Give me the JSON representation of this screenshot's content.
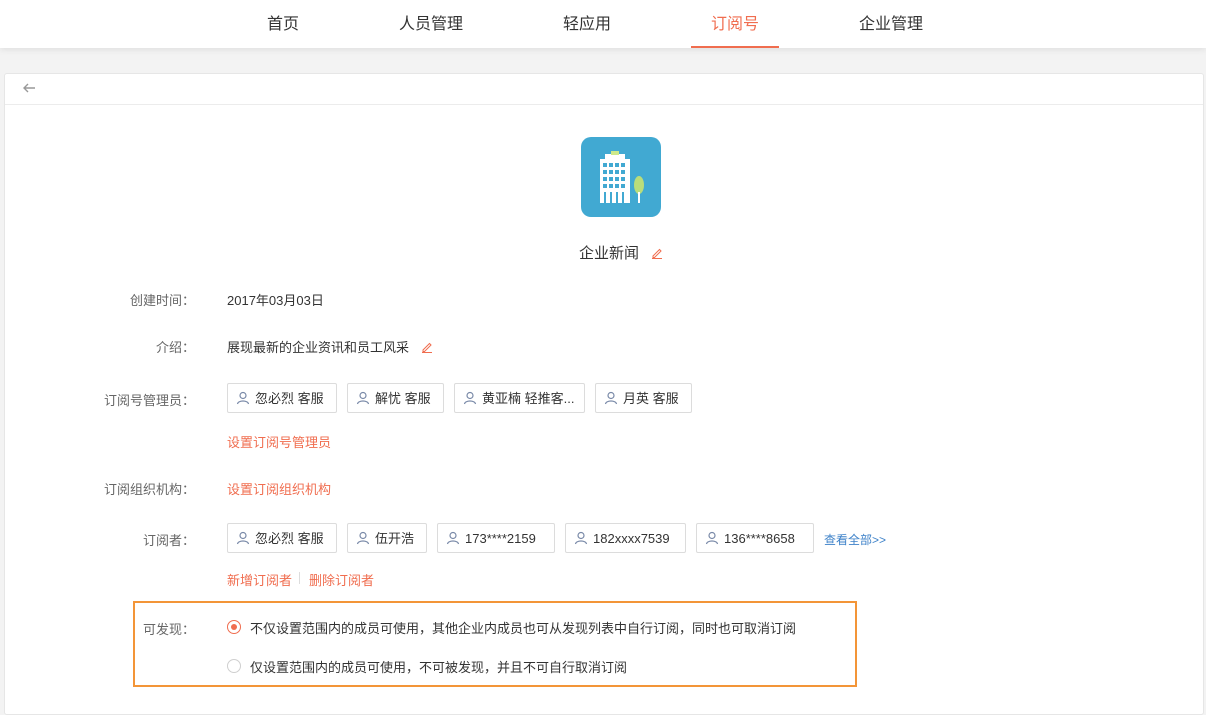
{
  "nav": {
    "tabs": [
      {
        "label": "首页"
      },
      {
        "label": "人员管理"
      },
      {
        "label": "轻应用"
      },
      {
        "label": "订阅号"
      },
      {
        "label": "企业管理"
      }
    ]
  },
  "app": {
    "name": "企业新闻",
    "logo_color": "#41a9d2"
  },
  "fields": {
    "created_label": "创建时间：",
    "created_value": "2017年03月03日",
    "intro_label": "介绍：",
    "intro_value": "展现最新的企业资讯和员工风采",
    "admins_label": "订阅号管理员：",
    "admins": [
      "忽必烈 客服",
      "解忧 客服",
      "黄亚楠 轻推客...",
      "月英 客服"
    ],
    "set_admins_link": "设置订阅号管理员",
    "org_label": "订阅组织机构：",
    "set_org_link": "设置订阅组织机构",
    "subscribers_label": "订阅者：",
    "subscribers": [
      "忽必烈 客服",
      "伍开浩",
      "173****2159",
      "182xxxx7539",
      "136****8658"
    ],
    "view_all_link": "查看全部>>",
    "add_subscriber_link": "新增订阅者",
    "remove_subscriber_link": "删除订阅者",
    "discover_label": "可发现：",
    "discover_option_1": "不仅设置范围内的成员可使用，其他企业内成员也可从发现列表中自行订阅，同时也可取消订阅",
    "discover_option_2": "仅设置范围内的成员可使用，不可被发现，并且不可自行取消订阅"
  },
  "colors": {
    "accent": "#f06d4f",
    "link_blue": "#3e82c9",
    "highlight": "#f39538"
  }
}
